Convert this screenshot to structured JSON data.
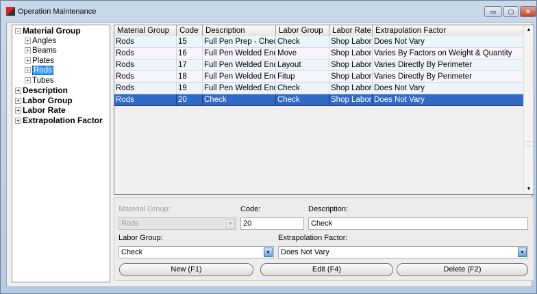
{
  "window": {
    "title": "Operation Maintenance",
    "min": "▭",
    "max": "▢",
    "close": "✕"
  },
  "tree": {
    "groups": [
      {
        "label": "Material Group",
        "expanded": true,
        "children": [
          "Angles",
          "Beams",
          "Plates",
          "Rods",
          "Tubes"
        ],
        "selected_child": "Rods"
      },
      {
        "label": "Description"
      },
      {
        "label": "Labor Group"
      },
      {
        "label": "Labor Rate"
      },
      {
        "label": "Extrapolation Factor"
      }
    ],
    "expand": "+",
    "collapse": "−"
  },
  "grid": {
    "columns": [
      "Material Group",
      "Code",
      "Description",
      "Labor Group",
      "Labor Rate",
      "Extrapolation Factor"
    ],
    "sort_indicator": "▲",
    "rows": [
      [
        "Rods",
        "15",
        "Full Pen Prep - Check",
        "Check",
        "Shop Labor",
        "Does Not Vary"
      ],
      [
        "Rods",
        "16",
        "Full Pen Welded End - Move",
        "Move",
        "Shop Labor",
        "Varies By Factors on Weight & Quantity"
      ],
      [
        "Rods",
        "17",
        "Full Pen Welded End - Layout",
        "Layout",
        "Shop Labor",
        "Varies Directly By Perimeter"
      ],
      [
        "Rods",
        "18",
        "Full Pen Welded End - Fitup",
        "Fitup",
        "Shop Labor",
        "Varies Directly By Perimeter"
      ],
      [
        "Rods",
        "19",
        "Full Pen Welded End - Check",
        "Check",
        "Shop Labor",
        "Does Not Vary"
      ],
      [
        "Rods",
        "20",
        "Check",
        "Check",
        "Shop Labor",
        "Does Not Vary"
      ]
    ],
    "selected_index": 5,
    "scroll_up": "▲",
    "scroll_down": "▼"
  },
  "form": {
    "material_group_label": "Material Group:",
    "material_group_value": "Rods",
    "code_label": "Code:",
    "code_value": "20",
    "description_label": "Description:",
    "description_value": "Check",
    "labor_group_label": "Labor Group:",
    "labor_group_value": "Check",
    "extrapolation_label": "Extrapolation Factor:",
    "extrapolation_value": "Does Not Vary",
    "dropdown_arrow": "▼",
    "new_button": "New (F1)",
    "edit_button": "Edit (F4)",
    "delete_button": "Delete (F2)"
  }
}
